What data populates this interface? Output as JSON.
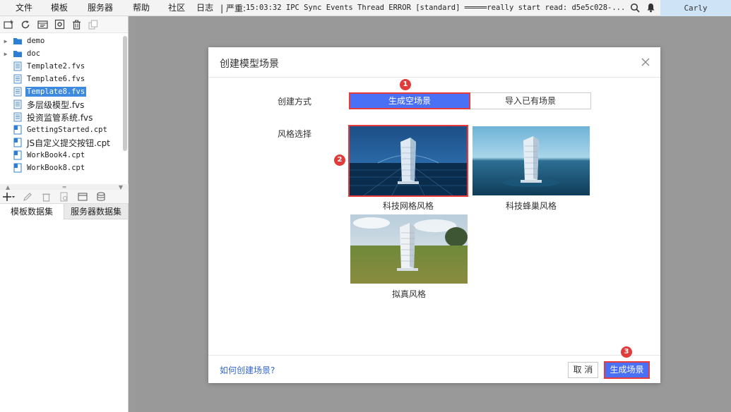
{
  "menubar": {
    "items": [
      "文件",
      "模板",
      "服务器",
      "帮助",
      "社区",
      "日志"
    ],
    "log_level": "| 严重:",
    "log_text": "15:03:32 IPC Sync Events Thread ERROR [standard] ═════really start read: d5e5c028-...",
    "user": "Carly"
  },
  "tree": {
    "items": [
      {
        "label": "demo",
        "type": "folder"
      },
      {
        "label": "doc",
        "type": "folder"
      },
      {
        "label": "Template2.fvs",
        "type": "fvs"
      },
      {
        "label": "Template6.fvs",
        "type": "fvs"
      },
      {
        "label": "Template8.fvs",
        "type": "fvs",
        "selected": true
      },
      {
        "label": "多层级模型.fvs",
        "type": "fvs"
      },
      {
        "label": "投资监管系统.fvs",
        "type": "fvs"
      },
      {
        "label": "GettingStarted.cpt",
        "type": "cpt"
      },
      {
        "label": "JS自定义提交按钮.cpt",
        "type": "cpt"
      },
      {
        "label": "WorkBook4.cpt",
        "type": "cpt"
      },
      {
        "label": "WorkBook8.cpt",
        "type": "cpt"
      }
    ]
  },
  "dataset_tabs": [
    "模板数据集",
    "服务器数据集"
  ],
  "dialog": {
    "title": "创建模型场景",
    "mode_label": "创建方式",
    "mode_options": [
      "生成空场景",
      "导入已有场景"
    ],
    "style_label": "风格选择",
    "styles": [
      "科技网格风格",
      "科技蜂巢风格",
      "拟真风格"
    ],
    "help_link": "如何创建场景?",
    "cancel": "取 消",
    "confirm": "生成场景",
    "badges": [
      "1",
      "2",
      "3"
    ]
  },
  "colors": {
    "primary": "#4a70f5",
    "highlight": "#e83a3a",
    "selected_tree": "#3d8ae0",
    "link": "#3366cc"
  }
}
